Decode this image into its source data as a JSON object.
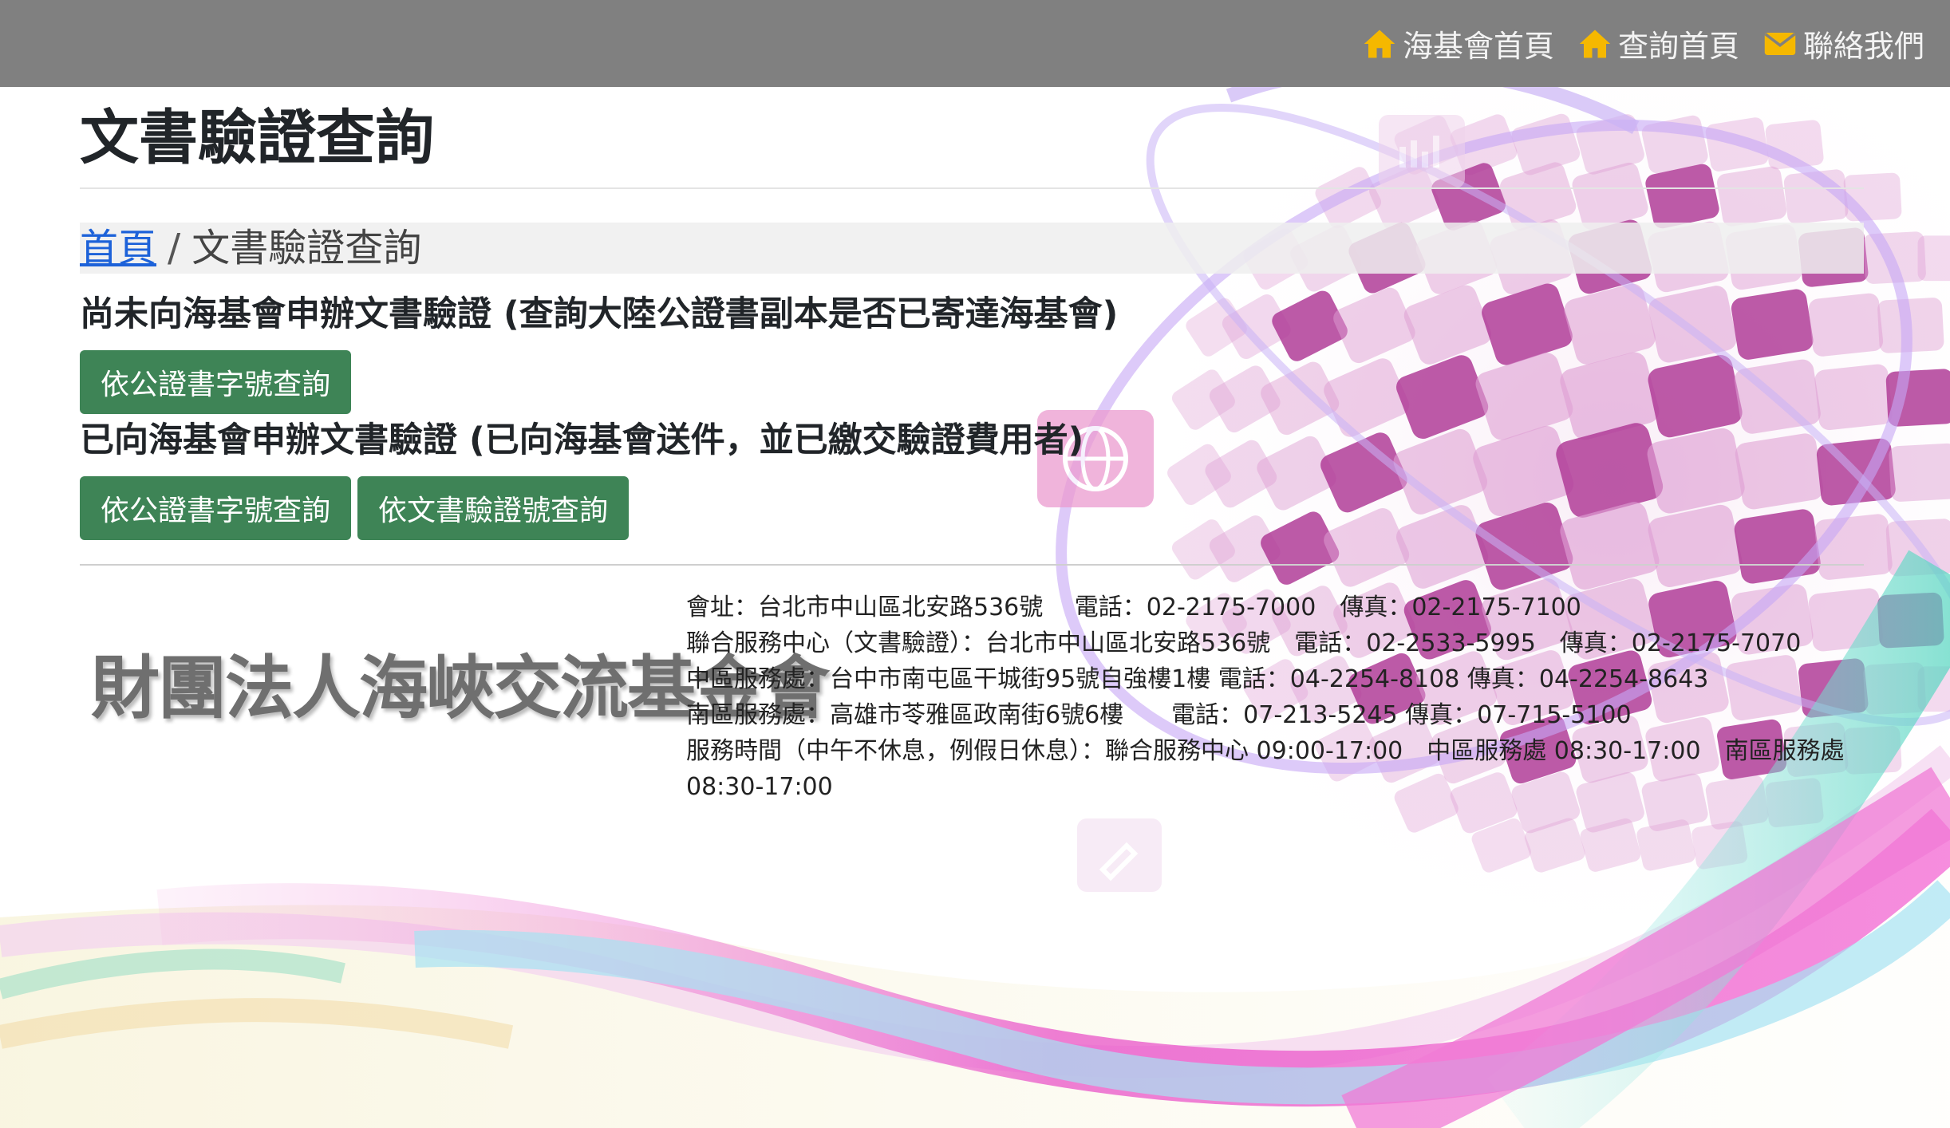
{
  "nav": {
    "items": [
      {
        "label": "海基會首頁",
        "icon": "home-icon"
      },
      {
        "label": "查詢首頁",
        "icon": "home-icon"
      },
      {
        "label": "聯絡我們",
        "icon": "envelope-icon"
      }
    ]
  },
  "page": {
    "title": "文書驗證查詢"
  },
  "breadcrumb": {
    "home": "首頁",
    "separator": "/",
    "current": "文書驗證查詢"
  },
  "sections": [
    {
      "heading": "尚未向海基會申辦文書驗證 (查詢大陸公證書副本是否已寄達海基會)",
      "buttons": [
        "依公證書字號查詢"
      ]
    },
    {
      "heading": "已向海基會申辦文書驗證 (已向海基會送件，並已繳交驗證費用者)",
      "buttons": [
        "依公證書字號查詢",
        "依文書驗證號查詢"
      ]
    }
  ],
  "footer": {
    "logo_text": "財團法人海峽交流基金會",
    "lines": [
      "會址：台北市中山區北安路536號　 電話：02-2175-7000　傳真：02-2175-7100",
      "聯合服務中心（文書驗證）：台北市中山區北安路536號　電話：02-2533-5995　傳真：02-2175-7070",
      "中區服務處：台中市南屯區干城街95號自強樓1樓 電話：04-2254-8108 傳真：04-2254-8643",
      "南區服務處：高雄市苓雅區政南街6號6樓　　電話：07-213-5245 傳真：07-715-5100",
      "服務時間（中午不休息，例假日休息）：聯合服務中心 09:00-17:00　中區服務處 08:30-17:00　南區服務處 08:30-17:00"
    ]
  },
  "colors": {
    "topbar": "#808080",
    "nav_icon": "#f5b800",
    "button": "#3e8456",
    "link": "#1d62d9"
  }
}
